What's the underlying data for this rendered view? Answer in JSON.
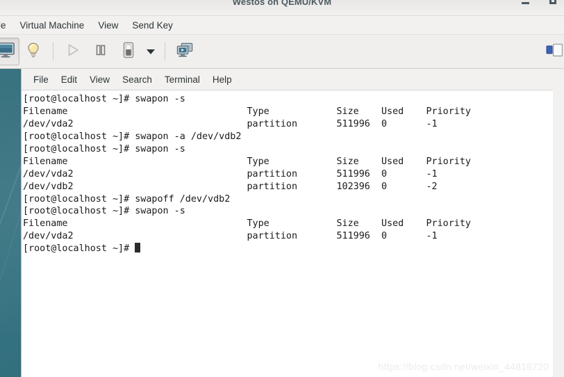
{
  "window": {
    "title": "Westos on QEMU/KVM",
    "controls": [
      {
        "name": "minimize",
        "label": "–"
      },
      {
        "name": "maximize",
        "label": "□"
      }
    ]
  },
  "menubar": {
    "items": [
      {
        "label": "le",
        "name": "file"
      },
      {
        "label": "Virtual Machine",
        "name": "virtual-machine"
      },
      {
        "label": "View",
        "name": "view"
      },
      {
        "label": "Send Key",
        "name": "send-key"
      }
    ]
  },
  "toolbar": {
    "buttons": [
      {
        "name": "show-console-icon",
        "title": "Show the graphical console",
        "state": "pressed"
      },
      {
        "name": "show-details-icon",
        "title": "Show virtual hardware details",
        "state": "normal"
      },
      {
        "name": "run-icon",
        "title": "Run",
        "state": "disabled"
      },
      {
        "name": "pause-icon",
        "title": "Pause",
        "state": "normal"
      },
      {
        "name": "shutdown-icon",
        "title": "Shut down",
        "state": "normal"
      },
      {
        "name": "shutdown-menu-arrow-icon",
        "title": "Shut down options",
        "state": "normal"
      },
      {
        "name": "fullscreen-icon",
        "title": "Fullscreen",
        "state": "normal"
      }
    ],
    "right_icon": {
      "name": "snapshots-icon",
      "title": "Manage VM snapshots"
    }
  },
  "terminal": {
    "menu": [
      {
        "label": "File",
        "name": "file"
      },
      {
        "label": "Edit",
        "name": "edit"
      },
      {
        "label": "View",
        "name": "view"
      },
      {
        "label": "Search",
        "name": "search"
      },
      {
        "label": "Terminal",
        "name": "terminal"
      },
      {
        "label": "Help",
        "name": "help"
      }
    ],
    "prompt": "[root@localhost ~]# ",
    "columns": {
      "filename": "Filename",
      "type": "Type",
      "size": "Size",
      "used": "Used",
      "priority": "Priority"
    },
    "lines": [
      "[root@localhost ~]# swapon -s",
      "Filename                                Type            Size    Used    Priority",
      "/dev/vda2                               partition       511996  0       -1",
      "[root@localhost ~]# swapon -a /dev/vdb2",
      "[root@localhost ~]# swapon -s",
      "Filename                                Type            Size    Used    Priority",
      "/dev/vda2                               partition       511996  0       -1",
      "/dev/vdb2                               partition       102396  0       -2",
      "[root@localhost ~]# swapoff /dev/vdb2",
      "[root@localhost ~]# swapon -s",
      "Filename                                Type            Size    Used    Priority",
      "/dev/vda2                               partition       511996  0       -1"
    ],
    "last_prompt": "[root@localhost ~]# ",
    "swap_entries": [
      {
        "filename": "/dev/vda2",
        "type": "partition",
        "size": "511996",
        "used": "0",
        "priority": "-1"
      },
      {
        "filename": "/dev/vdb2",
        "type": "partition",
        "size": "102396",
        "used": "0",
        "priority": "-2"
      }
    ],
    "commands": [
      "swapon -s",
      "swapon -a /dev/vdb2",
      "swapon -s",
      "swapoff /dev/vdb2",
      "swapon -s"
    ]
  },
  "watermark": {
    "text": "https://blog.csdn.net/weixin_44818720"
  },
  "colors": {
    "desktop_teal": "#31707f",
    "chrome_gray": "#f2f1f0",
    "terminal_bg": "#ffffff",
    "terminal_fg": "#1a1a1a",
    "title_fg": "#4b5a61"
  }
}
